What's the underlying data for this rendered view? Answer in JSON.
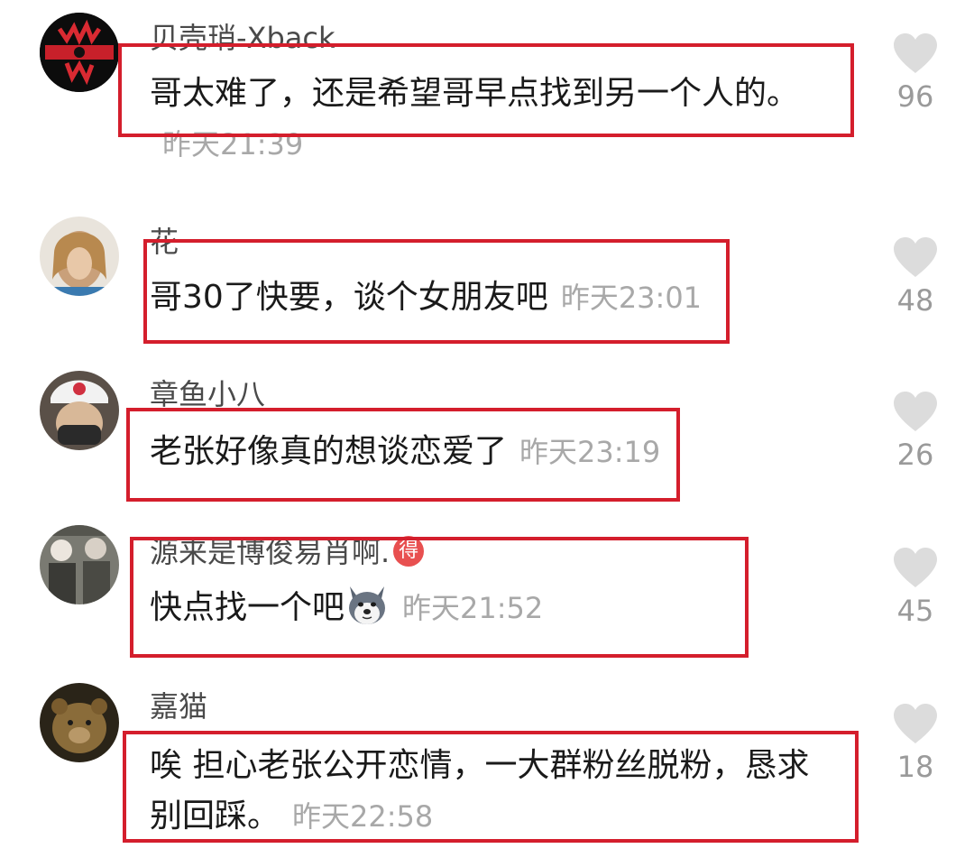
{
  "comments": [
    {
      "username": "贝壳琑-Xback",
      "text": "哥太难了，还是希望哥早点找到另一个人的。",
      "time": "昨天21:39",
      "likes": "96",
      "avatar": "avatar-red-logo"
    },
    {
      "username": "花",
      "text": "哥30了快要，谈个女朋友吧",
      "time": "昨天23:01",
      "likes": "48",
      "avatar": "avatar-photo-girl"
    },
    {
      "username": "章鱼小八",
      "text": "老张好像真的想谈恋爱了",
      "time": "昨天23:19",
      "likes": "26",
      "avatar": "avatar-photo-cap"
    },
    {
      "username": "源来是博俊易肖啊.",
      "badge": "得",
      "text": "快点找一个吧",
      "emoji": "husky-dog-emoji",
      "time": "昨天21:52",
      "likes": "45",
      "avatar": "avatar-photo-group"
    },
    {
      "username": "嘉猫",
      "text": "唉 担心老张公开恋情，一大群粉丝脱粉，恳求别回踩。",
      "time": "昨天22:58",
      "likes": "18",
      "avatar": "avatar-photo-bear"
    }
  ],
  "colors": {
    "highlight_box": "#d41e2c",
    "timestamp": "#a8a8a8",
    "like_icon": "#dcdcdc"
  }
}
